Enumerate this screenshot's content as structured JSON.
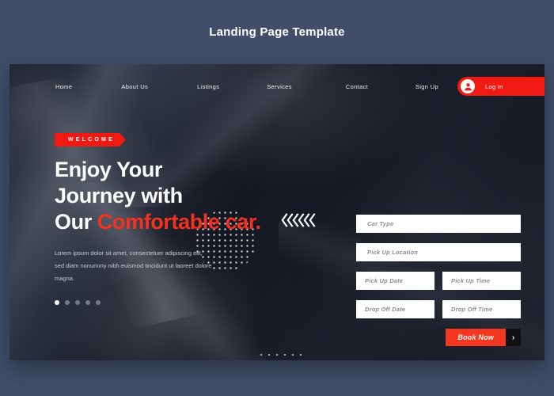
{
  "page": {
    "title": "Landing Page Template",
    "background_color": "#414d69"
  },
  "colors": {
    "accent_red": "#f01a12",
    "accent_red_bright": "#f4381f",
    "heading_white": "#ffffff",
    "arrow_dark": "#0f1116"
  },
  "hero": {
    "nav": {
      "links": [
        {
          "label": "Home"
        },
        {
          "label": "About Us"
        },
        {
          "label": "Listings"
        },
        {
          "label": "Services"
        },
        {
          "label": "Contact"
        }
      ],
      "signup_label": "Sign Up",
      "login_label": "Log In",
      "avatar_icon": "user-avatar-icon"
    },
    "badge": "WELCOME",
    "headline": {
      "line1": "Enjoy Your",
      "line2": "Journey with",
      "line3_plain": "Our ",
      "line3_accent": "Comfortable car."
    },
    "paragraph": "Lorem ipsum dolor sit amet, consectetuer adipiscing elit, sed diam nonummy nibh euismod tincidunt ut laoreet dolore magna.",
    "slider_dots": {
      "count": 5,
      "active_index": 0
    },
    "decorations": {
      "chevrons_icon": "chevron-left-group-icon",
      "chevron_count": 6,
      "dot_circle": "dot-pattern-circle",
      "dot_grid": "dot-pattern-grid"
    },
    "form": {
      "car_type": "Car Type",
      "pick_up_location": "Pick Up Location",
      "pick_up_date": "Pick Up Date",
      "pick_up_time": "Pick Up Time",
      "drop_off_date": "Drop Off Date",
      "drop_off_time": "Drop Off Time",
      "book_label": "Book Now",
      "book_arrow_icon": "chevron-right-icon"
    }
  }
}
